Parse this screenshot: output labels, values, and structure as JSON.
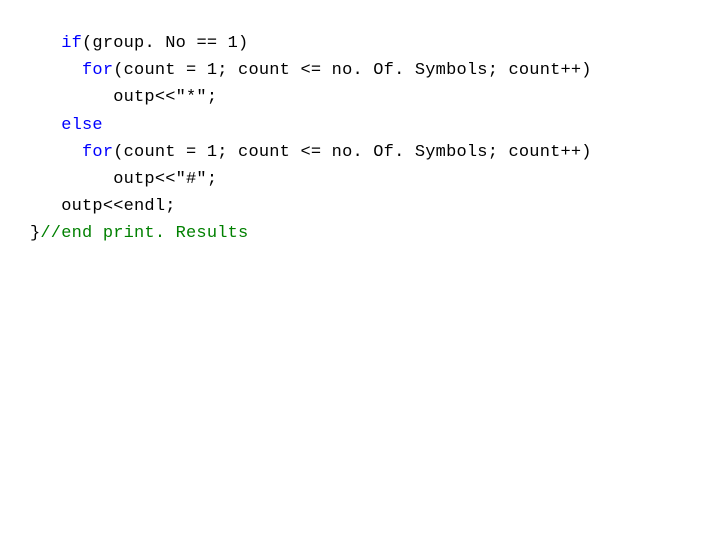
{
  "code": {
    "l1_indent": "   ",
    "l1_kw": "if",
    "l1_rest": "(group. No == 1)",
    "l2_indent": "     ",
    "l2_kw": "for",
    "l2_rest": "(count = 1; count <= no. Of. Symbols; count++)",
    "l3_indent": "        ",
    "l3_rest": "outp<<\"*\";",
    "l4_indent": "   ",
    "l4_kw": "else",
    "l5_indent": "     ",
    "l5_kw": "for",
    "l5_rest": "(count = 1; count <= no. Of. Symbols; count++)",
    "l6_indent": "        ",
    "l6_rest": "outp<<\"#\";",
    "l7_indent": "   ",
    "l7_rest": "outp<<endl;",
    "l8_brace": "}",
    "l8_comment": "//end print. Results"
  }
}
